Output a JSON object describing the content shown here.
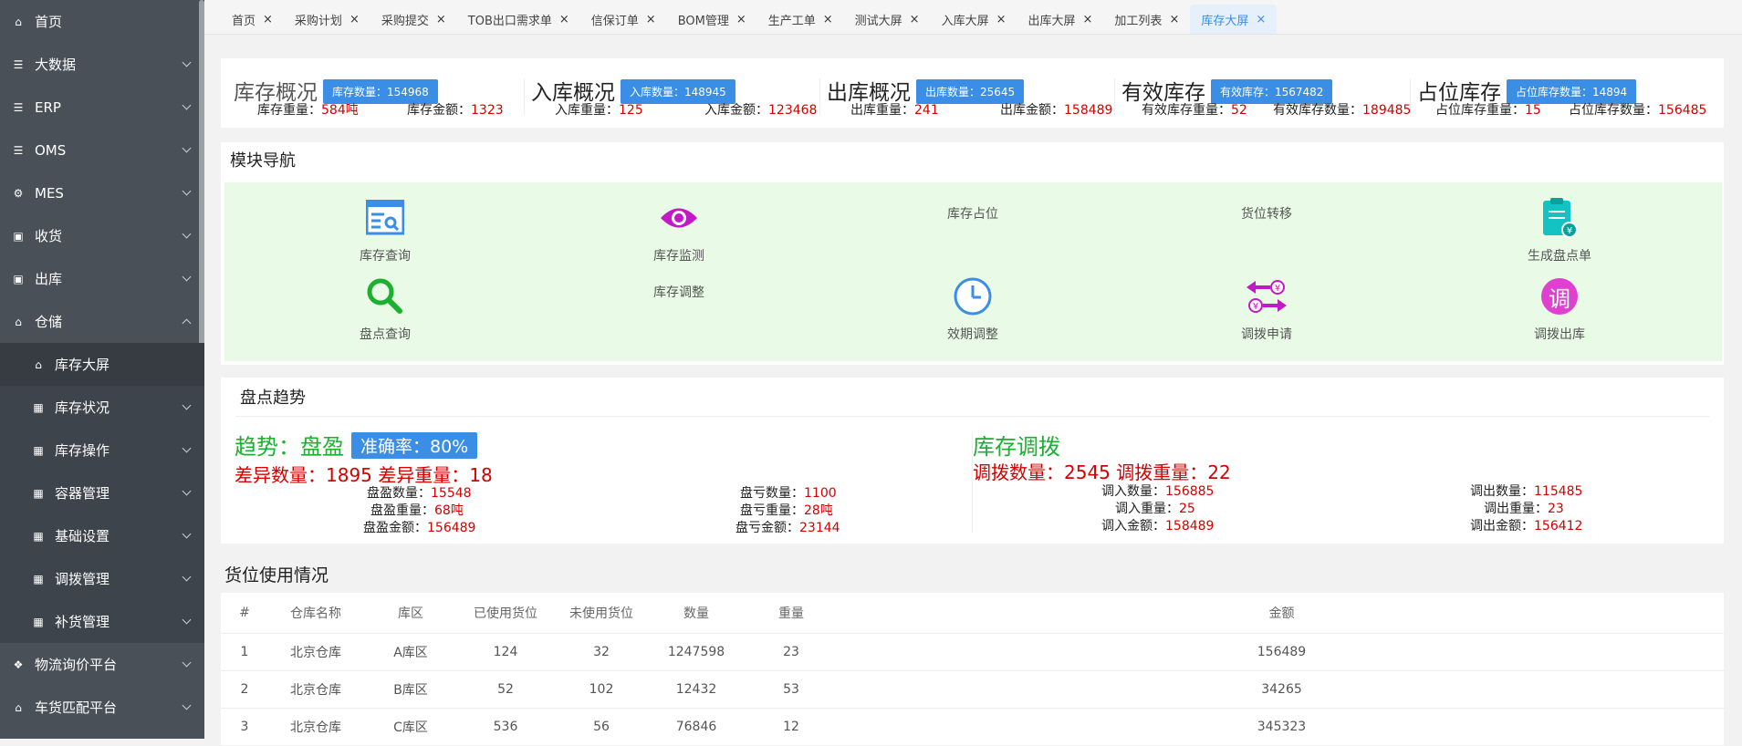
{
  "sidebar": {
    "items": [
      {
        "label": "首页",
        "icon": "home-icon",
        "glyph": "⌂",
        "chev": ""
      },
      {
        "label": "大数据",
        "icon": "list-icon",
        "glyph": "☰",
        "chev": "down"
      },
      {
        "label": "ERP",
        "icon": "list-icon",
        "glyph": "☰",
        "chev": "down"
      },
      {
        "label": "OMS",
        "icon": "list-icon",
        "glyph": "☰",
        "chev": "down"
      },
      {
        "label": "MES",
        "icon": "gear-icon",
        "glyph": "⚙",
        "chev": "down"
      },
      {
        "label": "收货",
        "icon": "inbox-icon",
        "glyph": "▣",
        "chev": "down"
      },
      {
        "label": "出库",
        "icon": "outbox-icon",
        "glyph": "▣",
        "chev": "down"
      },
      {
        "label": "仓储",
        "icon": "house-icon",
        "glyph": "⌂",
        "chev": "up"
      }
    ],
    "sub_items": [
      {
        "label": "库存大屏",
        "icon": "house-icon",
        "glyph": "⌂",
        "chev": "",
        "active": true
      },
      {
        "label": "库存状况",
        "icon": "grid-icon",
        "glyph": "▦",
        "chev": "down"
      },
      {
        "label": "库存操作",
        "icon": "grid-icon",
        "glyph": "▦",
        "chev": "down"
      },
      {
        "label": "容器管理",
        "icon": "grid-icon",
        "glyph": "▦",
        "chev": "down"
      },
      {
        "label": "基础设置",
        "icon": "grid-icon",
        "glyph": "▦",
        "chev": "down"
      },
      {
        "label": "调拨管理",
        "icon": "grid-icon",
        "glyph": "▦",
        "chev": "down"
      },
      {
        "label": "补货管理",
        "icon": "grid-icon",
        "glyph": "▦",
        "chev": "down"
      }
    ],
    "bottom_items": [
      {
        "label": "物流询价平台",
        "icon": "cubes-icon",
        "glyph": "❖",
        "chev": "down"
      },
      {
        "label": "车货匹配平台",
        "icon": "house-icon",
        "glyph": "⌂",
        "chev": "down"
      }
    ]
  },
  "tabs": [
    "首页",
    "采购计划",
    "采购提交",
    "TOB出口需求单",
    "信保订单",
    "BOM管理",
    "生产工单",
    "测试大屏",
    "入库大屏",
    "出库大屏",
    "加工列表",
    "库存大屏"
  ],
  "active_tab": 11,
  "tab_close": "×",
  "overview": {
    "stock": {
      "title": "库存概况",
      "badge": "库存数量：154968",
      "w_label": "库存重量：",
      "w_value": "584吨",
      "a_label": "库存金额：",
      "a_value": "1323"
    },
    "inbound": {
      "title": "入库概况",
      "badge": "入库数量：148945",
      "w_label": "入库重量：",
      "w_value": "125",
      "a_label": "入库金额：",
      "a_value": "123468"
    },
    "outbound": {
      "title": "出库概况",
      "badge": "出库数量：25645",
      "w_label": "出库重量：",
      "w_value": "241",
      "a_label": "出库金额：",
      "a_value": "158489"
    },
    "effective": {
      "title": "有效库存",
      "badge": "有效库存：1567482",
      "w_label": "有效库存重量：",
      "w_value": "52",
      "a_label": "有效库存数量：",
      "a_value": "189485"
    },
    "occupied": {
      "title": "占位库存",
      "badge": "占位库存数量：14894",
      "w_label": "占位库存重量：",
      "w_value": "15",
      "a_label": "占位库存数量：",
      "a_value": "156485"
    }
  },
  "module_nav": {
    "title": "模块导航",
    "items": {
      "stock_query": "库存查询",
      "stock_monitor": "库存监测",
      "stock_occupy": "库存占位",
      "slot_transfer": "货位转移",
      "gen_count": "生成盘点单",
      "count_query": "盘点查询",
      "stock_adjust": "库存调整",
      "expiry_adjust": "效期调整",
      "transfer_apply": "调拨申请",
      "transfer_out": "调拨出库"
    },
    "transfer_out_glyph": "调"
  },
  "count_trend": {
    "title": "盘点趋势",
    "trend_label": "趋势：盘盈",
    "accuracy": "准确率：80%",
    "diff_line": "差异数量：1895 差异重量：18",
    "gain_qty_label": "盘盈数量：",
    "gain_qty": "15548",
    "gain_w_label": "盘盈重量：",
    "gain_w": "68吨",
    "gain_amt_label": "盘盈金额：",
    "gain_amt": "156489",
    "loss_qty_label": "盘亏数量：",
    "loss_qty": "1100",
    "loss_w_label": "盘亏重量：",
    "loss_w": "28吨",
    "loss_amt_label": "盘亏金额：",
    "loss_amt": "23144",
    "transfer_title": "库存调拨",
    "transfer_line": "调拨数量：2545 调拨重量：22",
    "in_qty_label": "调入数量：",
    "in_qty": "156885",
    "in_w_label": "调入重量：",
    "in_w": "25",
    "in_amt_label": "调入金额：",
    "in_amt": "158489",
    "out_qty_label": "调出数量：",
    "out_qty": "115485",
    "out_w_label": "调出重量：",
    "out_w": "23",
    "out_amt_label": "调出金额：",
    "out_amt": "156412"
  },
  "slot_usage": {
    "title": "货位使用情况",
    "columns": [
      "#",
      "仓库名称",
      "库区",
      "已使用货位",
      "未使用货位",
      "数量",
      "重量",
      "金额"
    ],
    "rows": [
      [
        "1",
        "北京仓库",
        "A库区",
        "124",
        "32",
        "1247598",
        "23",
        "156489"
      ],
      [
        "2",
        "北京仓库",
        "B库区",
        "52",
        "102",
        "12432",
        "53",
        "34265"
      ],
      [
        "3",
        "北京仓库",
        "C库区",
        "536",
        "56",
        "76846",
        "12",
        "345323"
      ]
    ]
  }
}
